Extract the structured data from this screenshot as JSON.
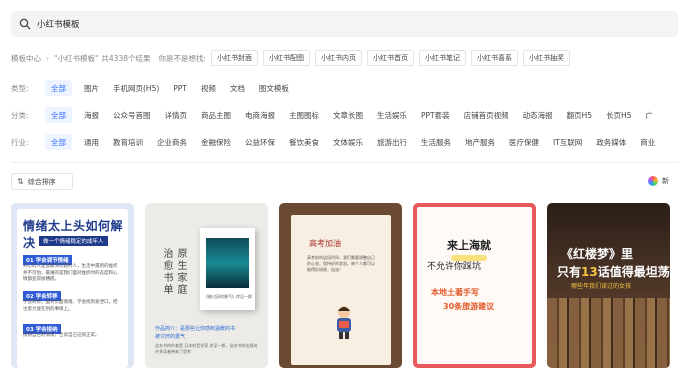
{
  "search": {
    "value": "小红书模板"
  },
  "breadcrumb": {
    "root": "模板中心",
    "query": "\"小红书模板\"",
    "count_text": "共4338个结果",
    "suggest_label": "你是不是想找:",
    "suggestions": [
      "小红书封面",
      "小红书配图",
      "小红书内页",
      "小红书首页",
      "小红书笔记",
      "小红书喜系",
      "小红书抽奖"
    ]
  },
  "filters": {
    "type": {
      "label": "类型:",
      "options": [
        "全部",
        "图片",
        "手机网页(H5)",
        "PPT",
        "视频",
        "文档",
        "图文模板"
      ]
    },
    "category": {
      "label": "分类:",
      "options": [
        "全部",
        "海报",
        "公众号首图",
        "详情页",
        "商品主图",
        "电商海报",
        "主图图标",
        "文章长图",
        "生活娱乐",
        "PPT套装",
        "店铺首页视频",
        "动态海报",
        "翻页H5",
        "长页H5",
        "广"
      ]
    },
    "industry": {
      "label": "行业:",
      "options": [
        "全部",
        "通用",
        "教育培训",
        "企业商务",
        "金融保险",
        "公益环保",
        "餐饮美食",
        "文体娱乐",
        "旅游出行",
        "生活服务",
        "地产服务",
        "医疗保健",
        "IT互联网",
        "政务媒体",
        "商业"
      ]
    }
  },
  "toolbar": {
    "sort_label": "综合排序",
    "new_label": "新"
  },
  "cards": {
    "c1": {
      "title": "情绪太上头如何解决",
      "subtitle": "做一个情绪稳定的成年人",
      "s1": "01 学会调节情绪",
      "t1": "开心的人是会解决问题的人，生活中遇到的挫折并不可怕，最难的是我们面对挫折时的态度和心情都变得很糟糕。",
      "s2": "02 学会转移",
      "t2": "学会转移，面对负面情绪，学会找到发泄口，把注意力放在别的事情上。",
      "s3": "03 学会接纳",
      "t3": "接纳自己的情绪，告诉自己这很正常。"
    },
    "c2": {
      "v1": "原生家庭",
      "v2": "治愈书单",
      "book_caption": "《被讨厌的勇气》岸见一郎",
      "hl1": "作品简介：是那些让你感到温暖的书",
      "hl2": "被讨厌的勇气",
      "foot": "这本书的作者是 日本的哲学家 岸见一郎，这本书的出版给许多读者带来了思考"
    },
    "c3": {
      "title": "高考加油",
      "text": "高考前的这段时间，我们需要调整自己的心态，保持好的状态。每个人都可以取得好成绩，加油！"
    },
    "c4": {
      "l1": "来上海就",
      "l2": "不允许你踩坑",
      "l3": "本地土著手写",
      "l4": "30条旅游建议"
    },
    "c5": {
      "l1": "《红楼梦》里",
      "l2a": "只有",
      "l2b": "13",
      "l2c": "话值得最坦荡",
      "l3": "哪些年我们读过的女孩"
    }
  },
  "colors": {
    "accent": "#2f6bff",
    "active_bg": "#eef4ff"
  }
}
